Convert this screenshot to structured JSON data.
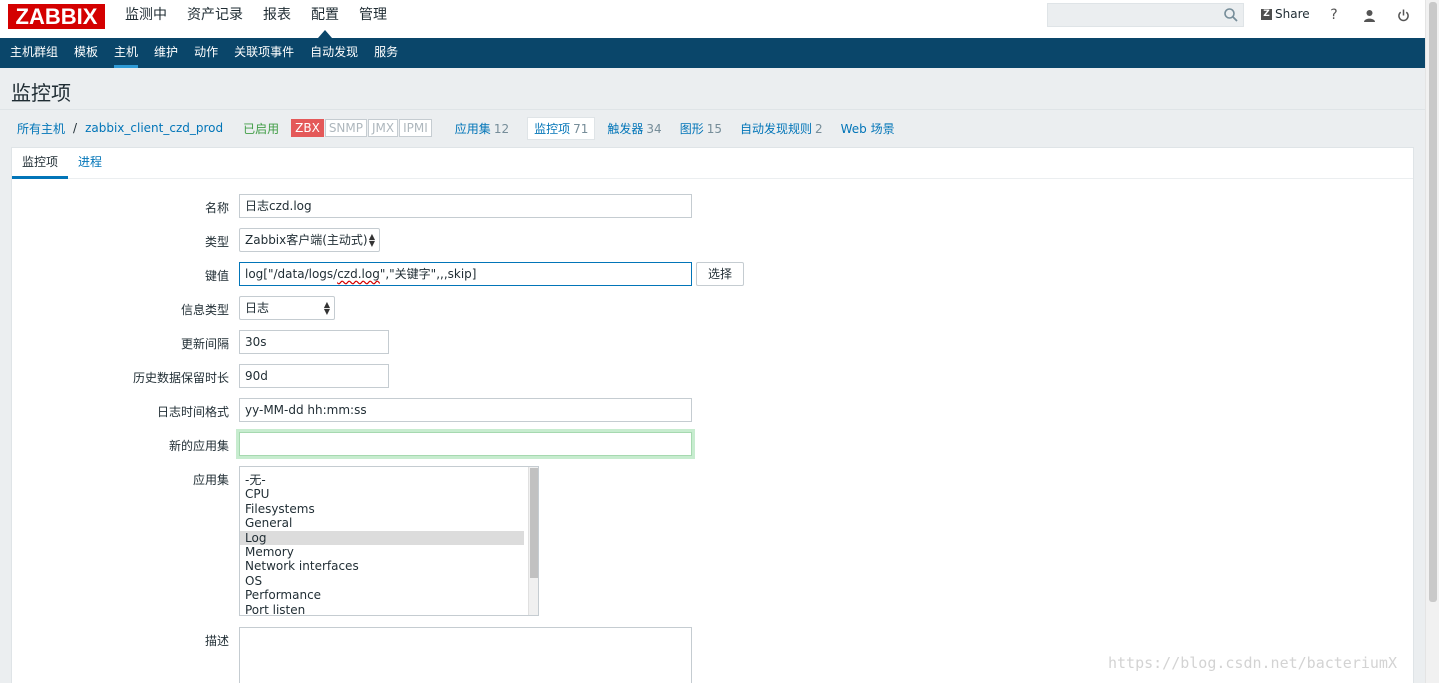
{
  "brand": {
    "logo_text": "ZABBIX",
    "logo_color": "#d40000"
  },
  "top_nav": {
    "items": [
      {
        "label": "监测中"
      },
      {
        "label": "资产记录"
      },
      {
        "label": "报表"
      },
      {
        "label": "配置",
        "active": true
      },
      {
        "label": "管理"
      }
    ]
  },
  "top_right": {
    "search_placeholder": "",
    "share_icon_text": "Z",
    "share_label": "Share",
    "help_icon": "?",
    "user_icon": "user-icon",
    "power_icon": "power-icon"
  },
  "sub_nav": {
    "items": [
      {
        "label": "主机群组"
      },
      {
        "label": "模板"
      },
      {
        "label": "主机",
        "active": true
      },
      {
        "label": "维护"
      },
      {
        "label": "动作"
      },
      {
        "label": "关联项事件"
      },
      {
        "label": "自动发现"
      },
      {
        "label": "服务"
      }
    ]
  },
  "page_title": "监控项",
  "breadcrumb": {
    "all_hosts": "所有主机",
    "separator": "/",
    "host": "zabbix_client_czd_prod"
  },
  "host_status": "已启用",
  "availability": [
    "ZBX",
    "SNMP",
    "JMX",
    "IPMI"
  ],
  "host_nav": [
    {
      "label": "应用集",
      "count": "12"
    },
    {
      "label": "监控项",
      "count": "71",
      "selected": true
    },
    {
      "label": "触发器",
      "count": "34"
    },
    {
      "label": "图形",
      "count": "15"
    },
    {
      "label": "自动发现规则",
      "count": "2"
    },
    {
      "label": "Web 场景",
      "count": ""
    }
  ],
  "tabs": [
    {
      "label": "监控项",
      "active": true
    },
    {
      "label": "进程"
    }
  ],
  "form": {
    "name": {
      "label": "名称",
      "value": "日志czd.log"
    },
    "type": {
      "label": "类型",
      "value": "Zabbix客户端(主动式)"
    },
    "key": {
      "label": "键值",
      "value_prefix": "log[\"/data/logs/",
      "value_mid": "czd.log",
      "value_suffix": "\",\"关键字\",,,skip]",
      "button": "选择"
    },
    "info_type": {
      "label": "信息类型",
      "value": "日志"
    },
    "update_interval": {
      "label": "更新间隔",
      "value": "30s"
    },
    "history": {
      "label": "历史数据保留时长",
      "value": "90d"
    },
    "log_time_format": {
      "label": "日志时间格式",
      "value": "yy-MM-dd hh:mm:ss"
    },
    "new_application": {
      "label": "新的应用集",
      "value": ""
    },
    "applications": {
      "label": "应用集",
      "options": [
        {
          "label": "-无-"
        },
        {
          "label": "CPU"
        },
        {
          "label": "Filesystems"
        },
        {
          "label": "General"
        },
        {
          "label": "Log",
          "selected": true
        },
        {
          "label": "Memory"
        },
        {
          "label": "Network interfaces"
        },
        {
          "label": "OS"
        },
        {
          "label": "Performance"
        },
        {
          "label": "Port listen"
        }
      ]
    },
    "description": {
      "label": "描述",
      "value": ""
    }
  },
  "watermark": "https://blog.csdn.net/bacteriumX",
  "colors": {
    "header_bg": "#0a466a",
    "link": "#0275b8",
    "enabled": "#429e47",
    "zbx_badge": "#e45959"
  }
}
